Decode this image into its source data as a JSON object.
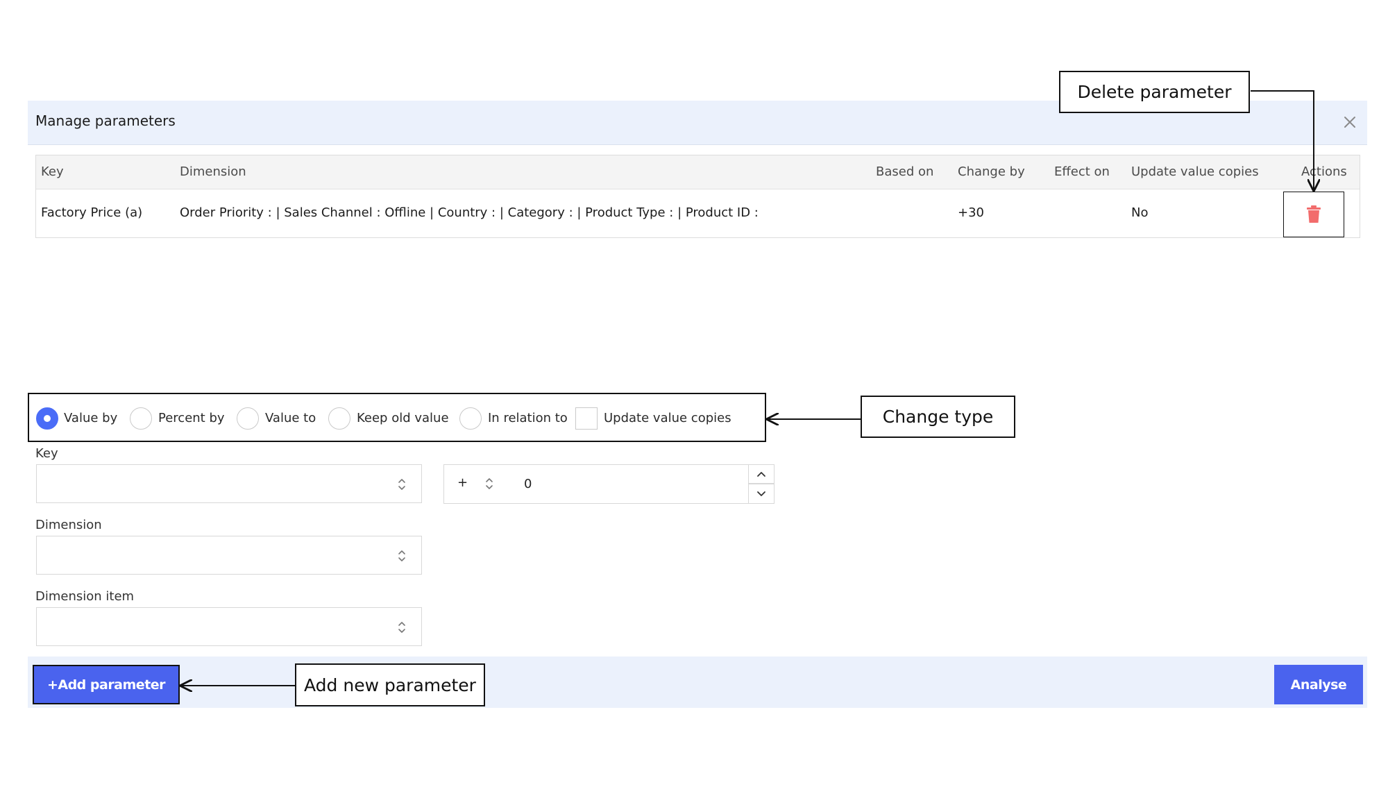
{
  "modal": {
    "title": "Manage parameters"
  },
  "table": {
    "headers": [
      "Key",
      "Dimension",
      "Based on",
      "Change by",
      "Effect on",
      "Update value copies",
      "Actions"
    ],
    "rows": [
      {
        "key": "Factory Price (a)",
        "dimension": "Order Priority : | Sales Channel : Offline | Country : | Category : | Product Type : | Product ID :",
        "based_on": "",
        "change_by": "+30",
        "effect_on": "",
        "update_value_copies": "No"
      }
    ]
  },
  "change_type": {
    "options": [
      "Value by",
      "Percent by",
      "Value to",
      "Keep old value",
      "In relation to"
    ],
    "selected": "Value by",
    "checkbox_label": "Update value copies",
    "checkbox_checked": false
  },
  "form": {
    "key_label": "Key",
    "key_value": "",
    "dimension_label": "Dimension",
    "dimension_value": "",
    "dimension_item_label": "Dimension item",
    "dimension_item_value": "",
    "sign_value": "+",
    "amount_value": "0"
  },
  "footer": {
    "add_label": "+Add parameter",
    "analyse_label": "Analyse"
  },
  "callouts": {
    "delete": "Delete parameter",
    "change_type": "Change type",
    "add_new": "Add new parameter"
  },
  "colors": {
    "accent": "#4a63ee",
    "header_bg": "#ebf1fc",
    "delete_icon": "#f26c6c"
  }
}
